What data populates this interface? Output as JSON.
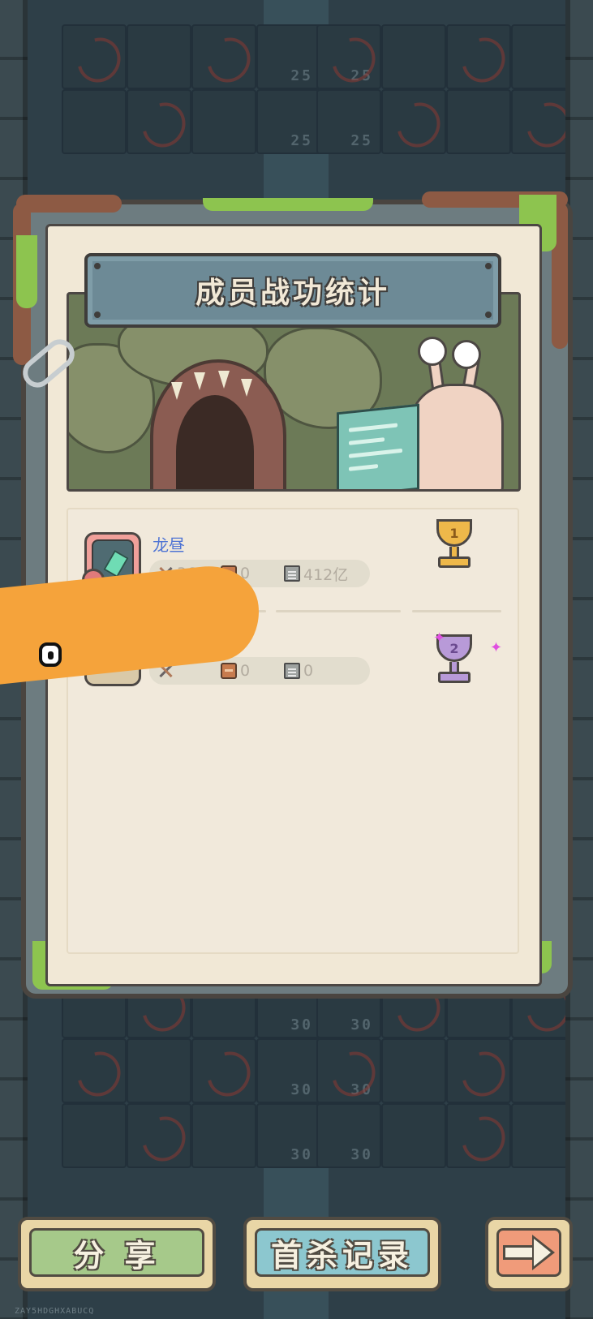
{
  "background": {
    "top_tile_numbers": [
      "25",
      "25",
      "25",
      "25"
    ],
    "bottom_tile_numbers": [
      "30",
      "30",
      "30",
      "30",
      "30",
      "30"
    ]
  },
  "panel": {
    "title": "成员战功统计"
  },
  "members": [
    {
      "name": "龙昼",
      "stats": {
        "kills": "36",
        "scrolls": "0",
        "damage": "412亿"
      },
      "rank": "1",
      "avatar_icon": "masked-warrior-avatar",
      "trophy_color": "#eeb84a"
    },
    {
      "name": "",
      "stats": {
        "kills": "",
        "scrolls": "0",
        "damage": "0"
      },
      "rank": "2",
      "avatar_icon": "hidden-avatar",
      "trophy_color": "#b89ad8"
    }
  ],
  "buttons": {
    "share": "分 享",
    "first_kill_record": "首杀记录",
    "next_icon": "arrow-right-icon"
  },
  "watermark": "ZAY5HDGHXABUCQ",
  "colors": {
    "name_blue": "#4f74d4",
    "blob_orange": "#f5a33b",
    "share_green": "#a6c98a",
    "record_blue": "#8cc7cf",
    "next_orange": "#f09b7a"
  }
}
